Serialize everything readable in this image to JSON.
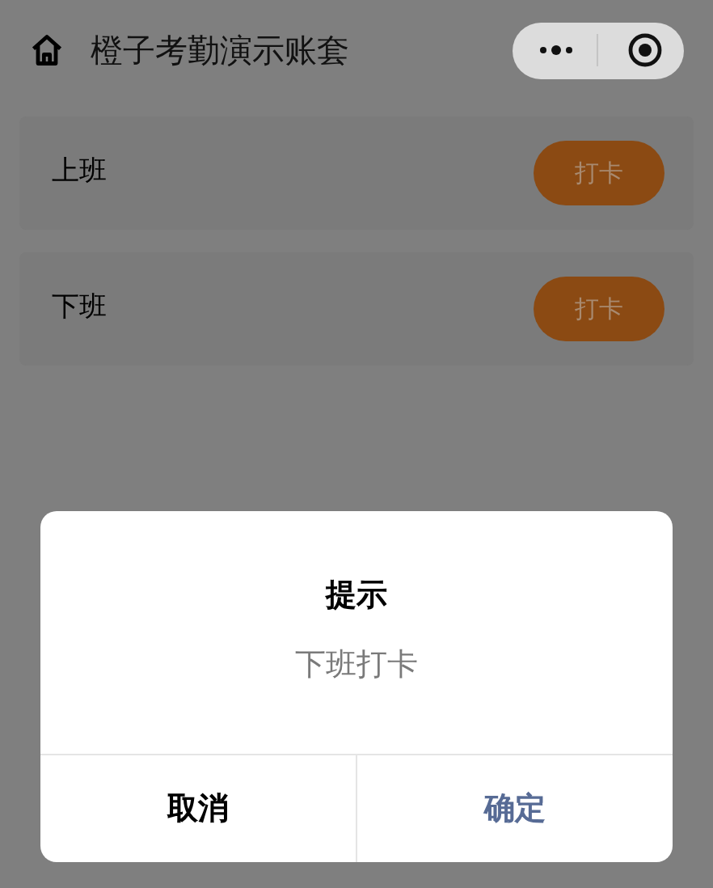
{
  "nav_bar": {
    "title": "橙子考勤演示账套"
  },
  "records": [
    {
      "label": "上班",
      "button": "打卡"
    },
    {
      "label": "下班",
      "button": "打卡"
    }
  ],
  "dialog": {
    "title": "提示",
    "message": "下班打卡",
    "buttons": [
      {
        "label": "取消",
        "kind": "cancel"
      },
      {
        "label": "确定",
        "kind": "confirm"
      }
    ]
  }
}
